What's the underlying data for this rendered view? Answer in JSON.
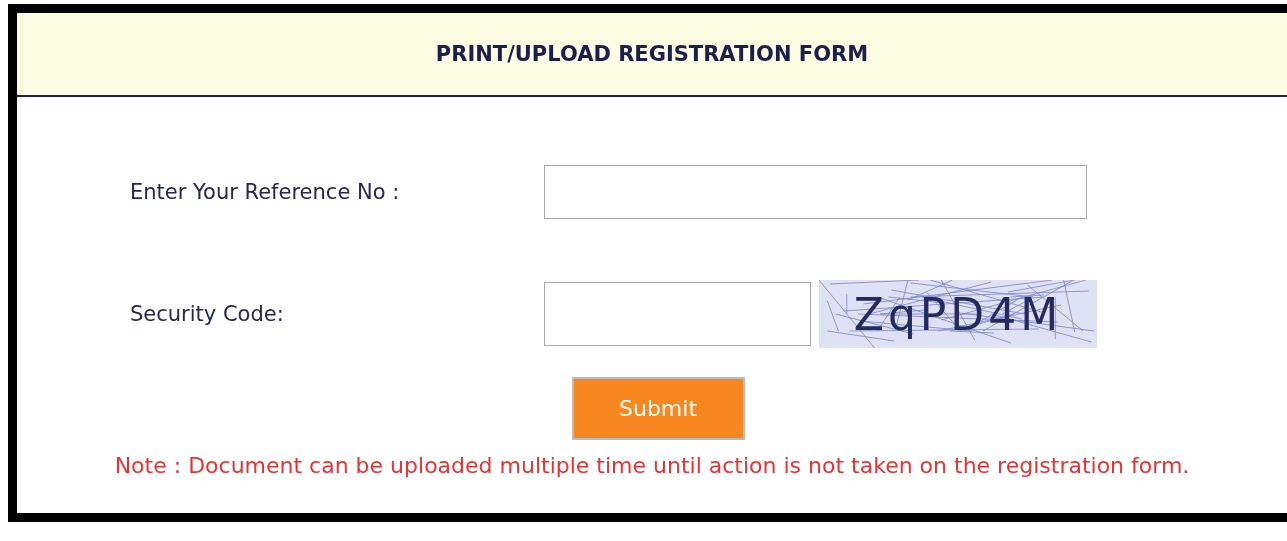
{
  "form": {
    "title": "PRINT/UPLOAD REGISTRATION FORM",
    "fields": [
      {
        "label": "Enter Your Reference No :",
        "kind": "text"
      },
      {
        "label": "Security Code:",
        "kind": "captcha",
        "captcha": "ZqPD4M"
      }
    ],
    "submit": "Submit",
    "note": "Note : Document can be uploaded multiple time until action is not taken on the registration form."
  }
}
